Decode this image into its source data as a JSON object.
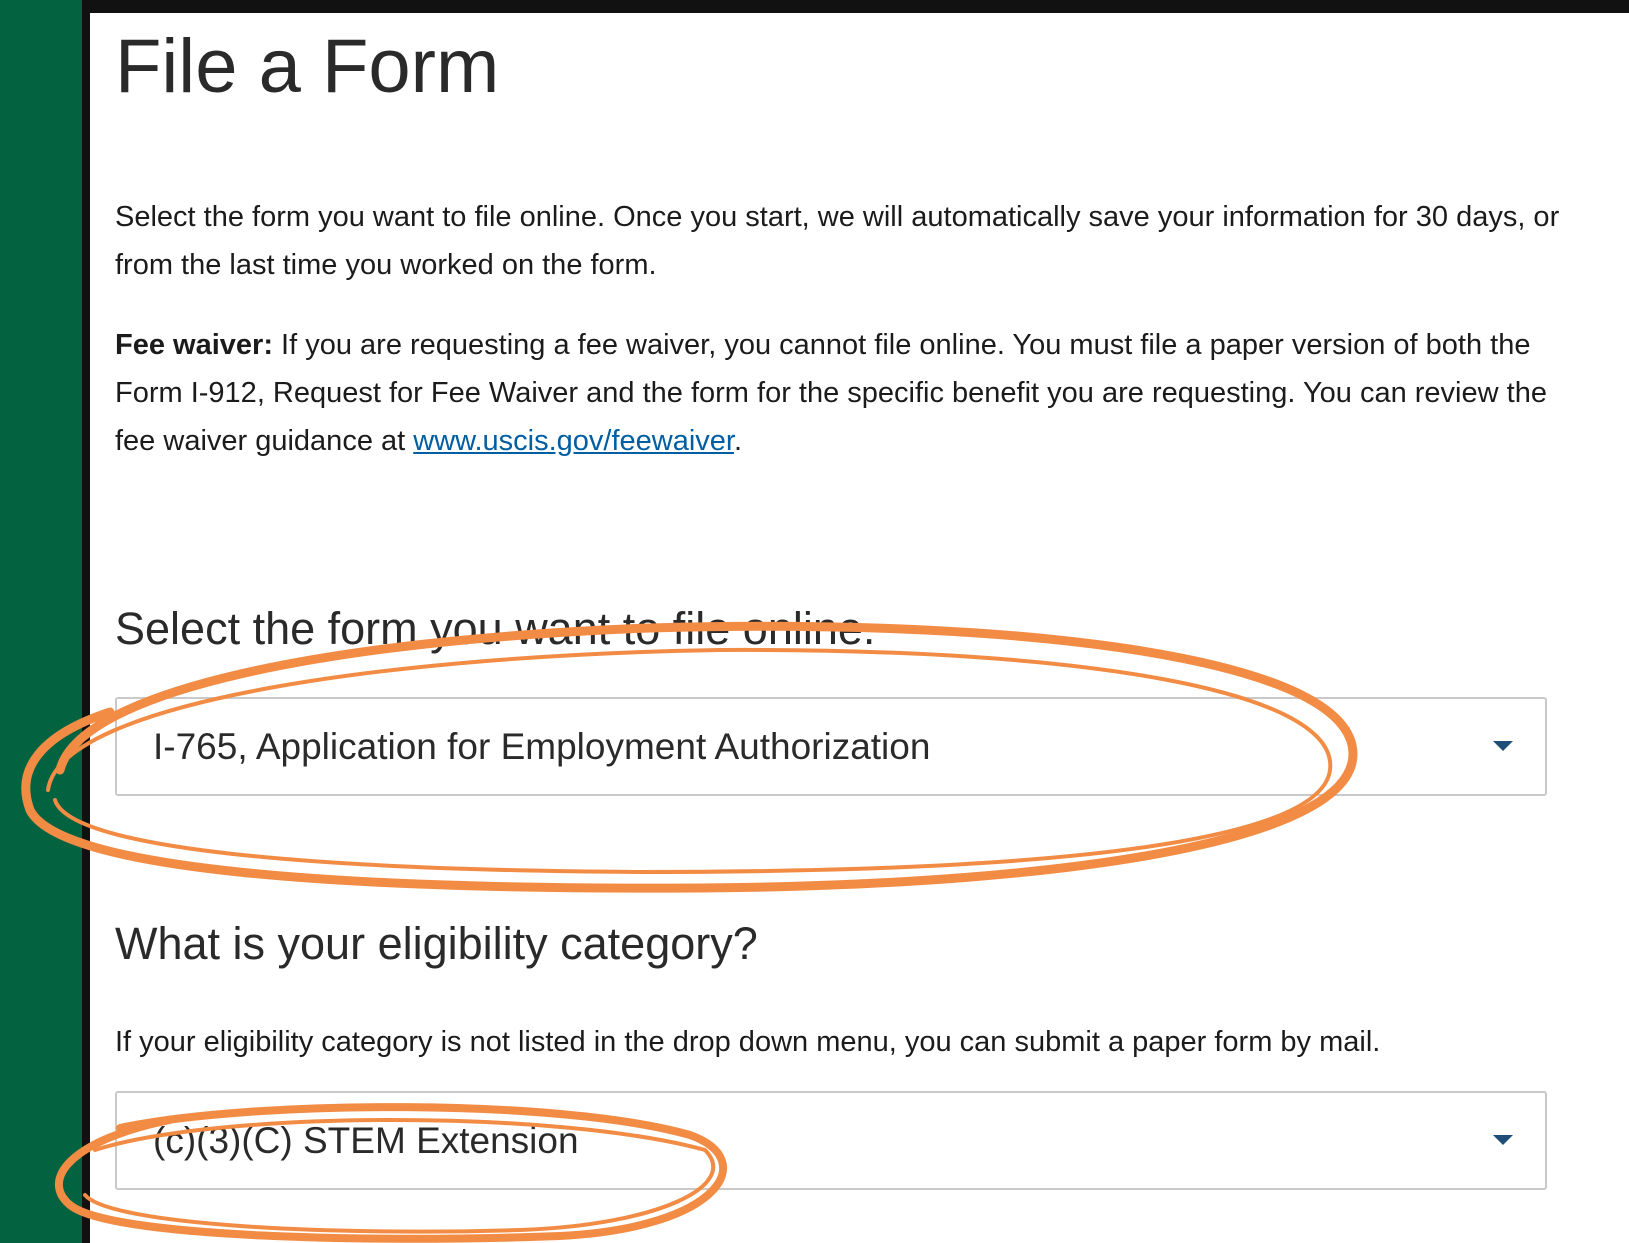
{
  "page": {
    "title": "File a Form",
    "intro": "Select the form you want to file online. Once you start, we will automatically save your information for 30 days, or from the last time you worked on the form.",
    "fee_waiver": {
      "label": "Fee waiver:",
      "text_before_link": " If you are requesting a fee waiver, you cannot file online. You must file a paper version of both the Form I-912, Request for Fee Waiver and the form for the specific benefit you are requesting. You can review the fee waiver guidance at ",
      "link_text": "www.uscis.gov/feewaiver",
      "text_after_link": "."
    }
  },
  "form_select": {
    "question": "Select the form you want to file online.",
    "value": "I-765, Application for Employment Authorization",
    "icon": "chevron-down-icon"
  },
  "eligibility_select": {
    "question": "What is your eligibility category?",
    "helper": "If your eligibility category is not listed in the drop down menu, you can submit a paper form by mail.",
    "value": "(c)(3)(C) STEM Extension",
    "icon": "chevron-down-icon"
  },
  "colors": {
    "frame_green": "#03623f",
    "annotation_orange": "#f28c45",
    "link_blue": "#005ea2",
    "caret_blue": "#1f4e79"
  }
}
